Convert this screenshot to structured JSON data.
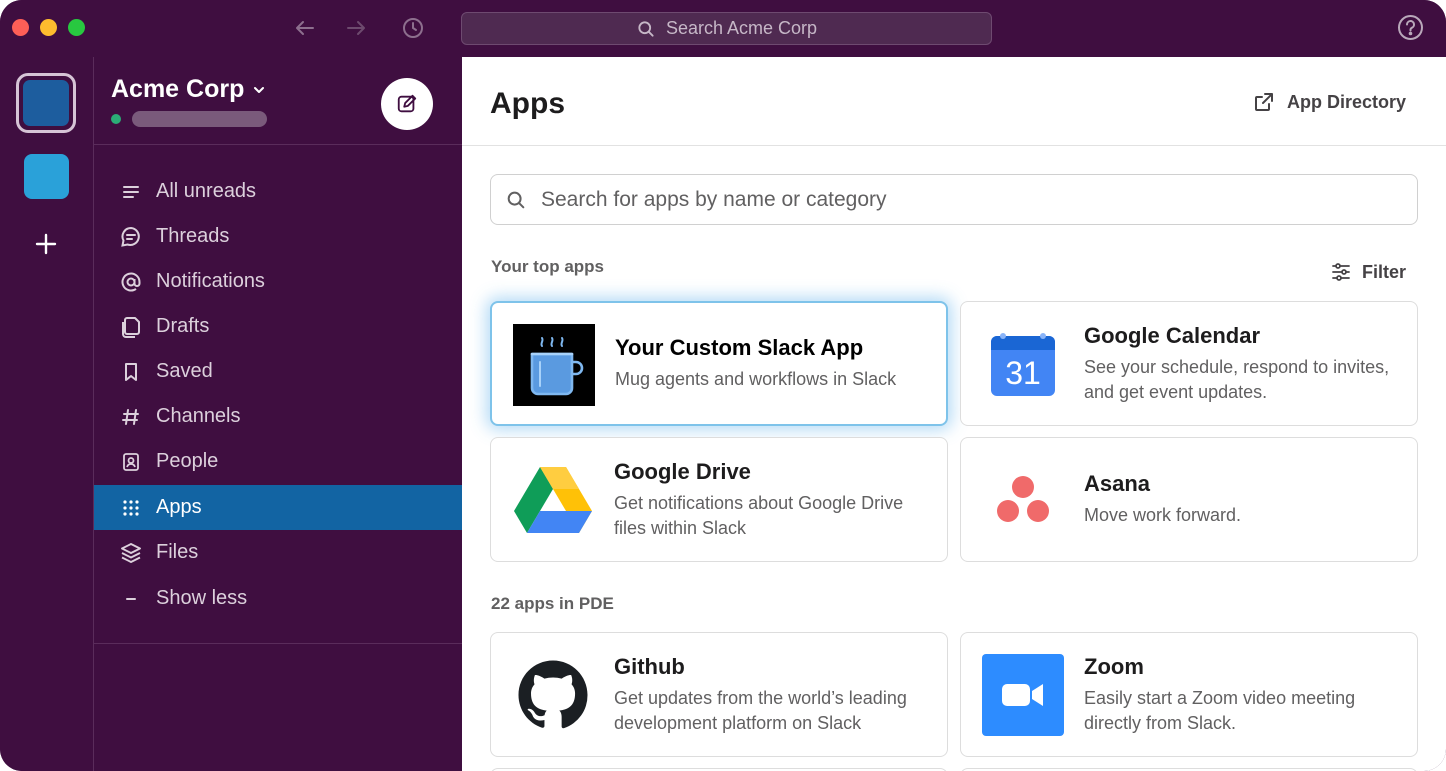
{
  "titlebar": {
    "search_placeholder": "Search Acme Corp",
    "back_icon": "arrow-left-icon",
    "forward_icon": "arrow-right-icon",
    "history_icon": "clock-icon",
    "help_icon": "question-circle-icon"
  },
  "workspace": {
    "name": "Acme Corp",
    "status_color": "#2bac76"
  },
  "sidebar": {
    "items": [
      {
        "label": "All unreads",
        "icon": "list-icon"
      },
      {
        "label": "Threads",
        "icon": "threads-icon"
      },
      {
        "label": "Notifications",
        "icon": "at-icon"
      },
      {
        "label": "Drafts",
        "icon": "drafts-icon"
      },
      {
        "label": "Saved",
        "icon": "bookmark-icon"
      },
      {
        "label": "Channels",
        "icon": "hash-icon"
      },
      {
        "label": "People",
        "icon": "contact-icon"
      },
      {
        "label": "Apps",
        "icon": "grid-icon"
      },
      {
        "label": "Files",
        "icon": "layers-icon"
      },
      {
        "label": "Show less",
        "icon": "minus-icon"
      }
    ],
    "active_item": "Apps"
  },
  "main": {
    "title": "Apps",
    "app_directory_label": "App Directory",
    "search_placeholder": "Search for apps by name or category",
    "top_apps_label": "Your top apps",
    "filter_label": "Filter",
    "workspace_apps_label": "22 apps in PDE",
    "top_apps": [
      {
        "name": "Your Custom Slack App",
        "desc": "Mug agents and workflows in Slack",
        "icon": "mug-icon"
      },
      {
        "name": "Google Calendar",
        "desc": "See your schedule, respond to invites, and get event updates.",
        "icon": "google-calendar-icon",
        "icon_text": "31"
      },
      {
        "name": "Google Drive",
        "desc": "Get notifications about Google Drive files within Slack",
        "icon": "google-drive-icon"
      },
      {
        "name": "Asana",
        "desc": "Move work forward.",
        "icon": "asana-icon"
      }
    ],
    "workspace_apps": [
      {
        "name": "Github",
        "desc": "Get updates from the world’s leading development platform on Slack",
        "icon": "github-icon"
      },
      {
        "name": "Zoom",
        "desc": "Easily start a Zoom video meeting directly from Slack.",
        "icon": "zoom-icon"
      }
    ]
  },
  "colors": {
    "aubergine": "#3f0e40",
    "active_blue": "#1264a3",
    "highlight_glow": "#7ec3ea"
  }
}
